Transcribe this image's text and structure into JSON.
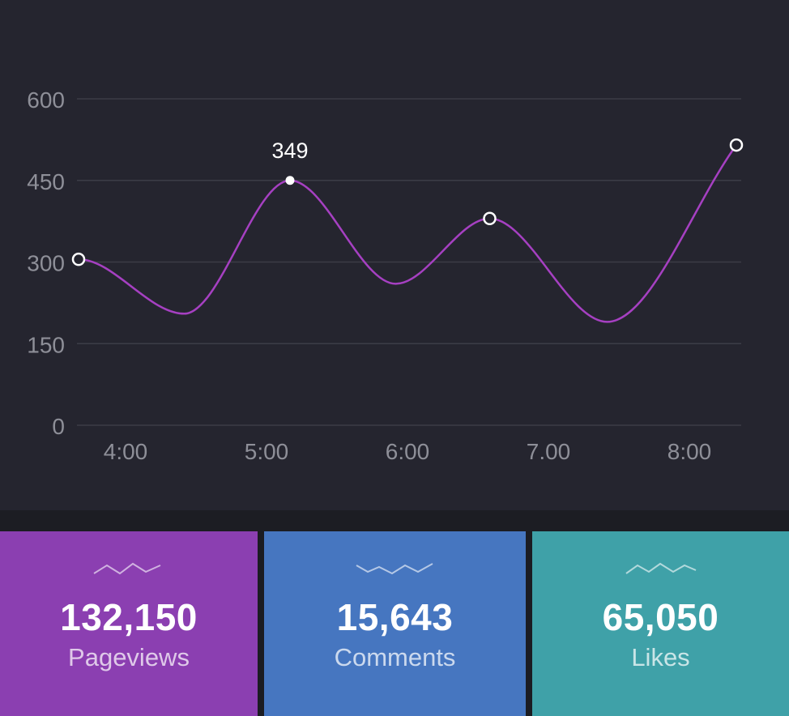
{
  "chart_data": {
    "type": "line",
    "x_tick_labels": [
      "4:00",
      "5:00",
      "6:00",
      "7.00",
      "8:00"
    ],
    "y_tick_labels": [
      "0",
      "150",
      "300",
      "450",
      "600"
    ],
    "ylim": [
      0,
      600
    ],
    "grid": true,
    "series": [
      {
        "color": "#a640c2",
        "points": [
          {
            "x": "3:40",
            "y": 305,
            "marker": "hollow"
          },
          {
            "x": "4:25",
            "y": 205
          },
          {
            "x": "5:10",
            "y": 450,
            "marker": "solid",
            "label": "349"
          },
          {
            "x": "5:55",
            "y": 260
          },
          {
            "x": "6:35",
            "y": 380,
            "marker": "hollow"
          },
          {
            "x": "7:25",
            "y": 190
          },
          {
            "x": "8:20",
            "y": 515,
            "marker": "hollow"
          }
        ]
      }
    ],
    "colors": {
      "background": "#25252f",
      "grid": "#3c3d47",
      "tick_text": "#8e8f98",
      "label_text": "#ffffff"
    }
  },
  "stats": [
    {
      "value": "132,150",
      "label": "Pageviews",
      "color": "#8b3fb1",
      "icon": "trend-line-icon"
    },
    {
      "value": "15,643",
      "label": "Comments",
      "color": "#4676c0",
      "icon": "trend-line-icon"
    },
    {
      "value": "65,050",
      "label": "Likes",
      "color": "#3fa1a8",
      "icon": "trend-line-icon"
    }
  ]
}
